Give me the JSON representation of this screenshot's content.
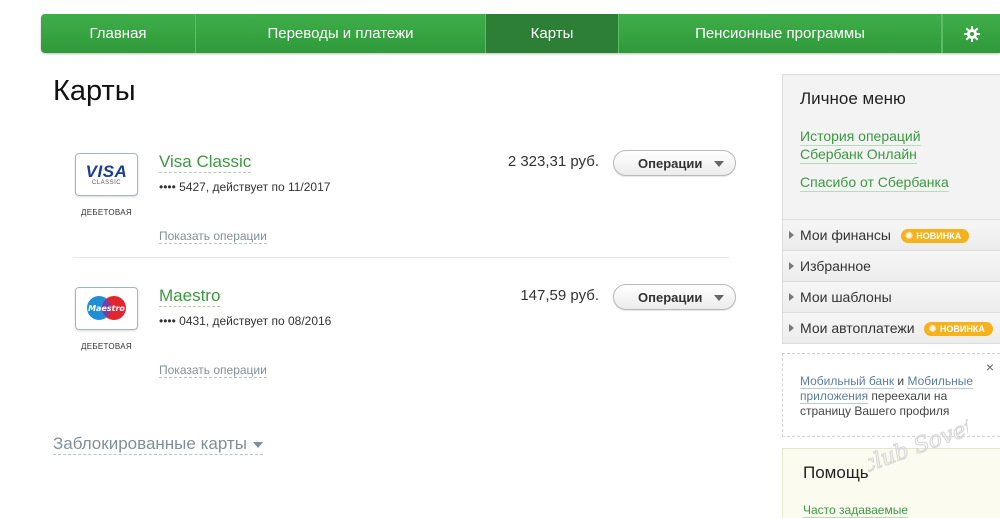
{
  "nav": {
    "tabs": [
      {
        "label": "Главная"
      },
      {
        "label": "Переводы и платежи"
      },
      {
        "label": "Карты"
      },
      {
        "label": "Пенсионные программы"
      }
    ],
    "active_tab": "Карты"
  },
  "page": {
    "title": "Карты"
  },
  "cards": [
    {
      "name": "Visa Classic",
      "logo_text": "VISA",
      "logo_sub": "CLASSIC",
      "type": "ДЕБЕТОВАЯ",
      "info": "•••• 5427, действует по 11/2017",
      "balance": "2 323,31 руб.",
      "ops_button": "Операции",
      "ops_link": "Показать операции"
    },
    {
      "name": "Maestro",
      "logo_text": "Maestro",
      "type": "ДЕБЕТОВАЯ",
      "info": "•••• 0431, действует по 08/2016",
      "balance": "147,59 руб.",
      "ops_button": "Операции",
      "ops_link": "Показать операции"
    }
  ],
  "blocked": {
    "label": "Заблокированные карты"
  },
  "sidebar": {
    "title": "Личное меню",
    "links": [
      {
        "label": "История операций"
      },
      {
        "label": "Сбербанк Онлайн"
      },
      {
        "label": "Спасибо от Сбербанка"
      }
    ],
    "items": [
      {
        "label": "Мои финансы",
        "badge": "НОВИНКА"
      },
      {
        "label": "Избранное"
      },
      {
        "label": "Мои шаблоны"
      },
      {
        "label": "Мои автоплатежи",
        "badge": "НОВИНКА"
      }
    ]
  },
  "notice": {
    "link1": "Мобильный банк",
    "and": " и ",
    "link2": "Мобильные приложения",
    "rest": " переехали на страницу Вашего профиля",
    "close": "×"
  },
  "help": {
    "title": "Помощь",
    "link": "Часто задаваемые"
  },
  "watermark": {
    "text": "club Sovet"
  },
  "colors": {
    "nav_green": "#3fae49",
    "nav_active": "#2d7f35",
    "link_green": "#3a9a3f",
    "badge_orange": "#f5b21c"
  }
}
